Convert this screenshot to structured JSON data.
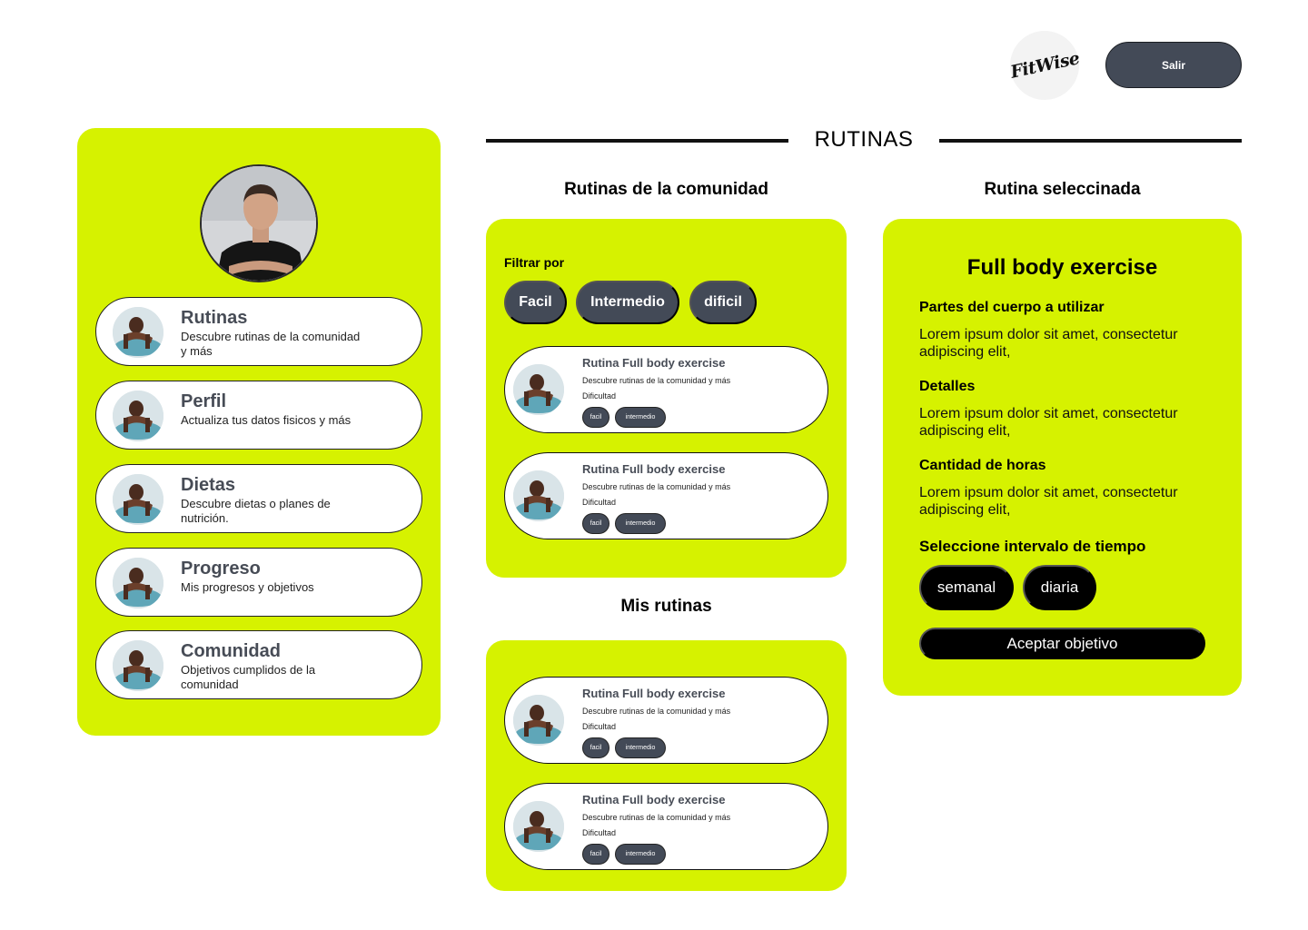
{
  "header": {
    "logo_text": "FitWise",
    "logout_label": "Salir"
  },
  "sidebar": {
    "items": [
      {
        "title": "Rutinas",
        "subtitle": "Descubre rutinas de la comunidad y más"
      },
      {
        "title": "Perfil",
        "subtitle": "Actualiza tus datos fisicos y más"
      },
      {
        "title": "Dietas",
        "subtitle": "Descubre dietas o planes de nutrición."
      },
      {
        "title": "Progreso",
        "subtitle": "Mis progresos y objetivos"
      },
      {
        "title": "Comunidad",
        "subtitle": "Objetivos cumplidos de la comunidad"
      }
    ]
  },
  "main": {
    "heading": "RUTINAS",
    "community_title": "Rutinas de la comunidad",
    "my_routines_title": "Mis rutinas",
    "selected_title": "Rutina seleccinada",
    "filter_label": "Filtrar por",
    "filters": [
      "Facil",
      "Intermedio",
      "dificil"
    ],
    "community_routines": [
      {
        "title": "Rutina Full body exercise",
        "description": "Descubre rutinas de la comunidad y más",
        "difficulty_label": "Dificultad",
        "tags": [
          "facil",
          "intermedio"
        ]
      },
      {
        "title": "Rutina Full body exercise",
        "description": "Descubre rutinas de la comunidad y más",
        "difficulty_label": "Dificultad",
        "tags": [
          "facil",
          "intermedio"
        ]
      }
    ],
    "my_routines": [
      {
        "title": "Rutina Full body exercise",
        "description": "Descubre rutinas de la comunidad y más",
        "difficulty_label": "Dificultad",
        "tags": [
          "facil",
          "intermedio"
        ]
      },
      {
        "title": "Rutina Full body exercise",
        "description": "Descubre rutinas de la comunidad y más",
        "difficulty_label": "Dificultad",
        "tags": [
          "facil",
          "intermedio"
        ]
      }
    ]
  },
  "detail": {
    "title": "Full body exercise",
    "sections": [
      {
        "heading": "Partes del cuerpo a  utilizar",
        "text": "Lorem ipsum dolor sit amet, consectetur adipiscing elit,"
      },
      {
        "heading": "Detalles",
        "text": "Lorem ipsum dolor sit amet, consectetur adipiscing elit,"
      },
      {
        "heading": "Cantidad de horas",
        "text": "Lorem ipsum dolor sit amet, consectetur adipiscing elit,"
      }
    ],
    "interval_heading": "Seleccione intervalo de tiempo",
    "intervals": [
      "semanal",
      "diaria"
    ],
    "accept_label": "Aceptar objetivo"
  },
  "colors": {
    "accent": "#d6f200",
    "dark_chip": "#434a57",
    "black": "#000000"
  }
}
